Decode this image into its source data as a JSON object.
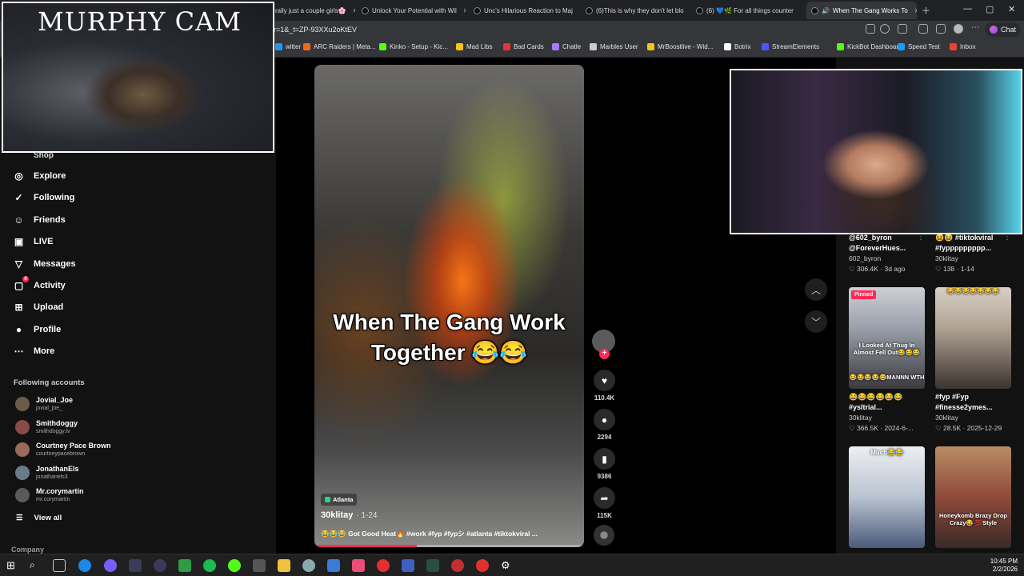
{
  "browser": {
    "tabs": [
      {
        "title": "rally just a couple girls🌸"
      },
      {
        "title": "Unlock Your Potential with Wil"
      },
      {
        "title": "Unc's Hilarious Reaction to Maj"
      },
      {
        "title": "(6)This is why they don't let blo"
      },
      {
        "title": "(6) 💙🌿 For all things counter"
      },
      {
        "title": "When The Gang Works To"
      }
    ],
    "url": "r=1&_t=ZP-93XXu2oKtEV",
    "chat_label": "Chat",
    "bookmarks": [
      {
        "label": "witter",
        "color": "#1d9bf0"
      },
      {
        "label": "ARC Raiders | Meta...",
        "color": "#f06a1d"
      },
      {
        "label": "Kinko - Setup - Kic...",
        "color": "#53fc18"
      },
      {
        "label": "Mad Libs",
        "color": "#f5c518"
      },
      {
        "label": "Bad Cards",
        "color": "#e33"
      },
      {
        "label": "Chatle",
        "color": "#a57cff"
      },
      {
        "label": "Marbles User",
        "color": "#ccc"
      },
      {
        "label": "MrBoostlive - Wid...",
        "color": "#f5c518"
      },
      {
        "label": "Botrix",
        "color": "#fff"
      },
      {
        "label": "StreamElements",
        "color": "#4b57ff"
      },
      {
        "label": "KickBot Dashboard",
        "color": "#53fc18"
      },
      {
        "label": "Speed Test",
        "color": "#1d9bf0"
      },
      {
        "label": "Inbox",
        "color": "#ea4335"
      }
    ]
  },
  "overlays": {
    "murphy_cam_title": "MURPHY CAM"
  },
  "sidebar": {
    "shop": "Shop",
    "items": [
      {
        "label": "Explore",
        "icon": "compass-icon",
        "glyph": "◎"
      },
      {
        "label": "Following",
        "icon": "following-icon",
        "glyph": "✓"
      },
      {
        "label": "Friends",
        "icon": "friends-icon",
        "glyph": "☺"
      },
      {
        "label": "LIVE",
        "icon": "live-icon",
        "glyph": "▣"
      },
      {
        "label": "Messages",
        "icon": "messages-icon",
        "glyph": "▽"
      },
      {
        "label": "Activity",
        "icon": "activity-icon",
        "glyph": "▢",
        "badge": "6"
      },
      {
        "label": "Upload",
        "icon": "upload-icon",
        "glyph": "⊞"
      },
      {
        "label": "Profile",
        "icon": "profile-icon",
        "glyph": "●"
      },
      {
        "label": "More",
        "icon": "more-icon",
        "glyph": "⋯"
      }
    ],
    "following_title": "Following accounts",
    "accounts": [
      {
        "name": "Jovial_Joe",
        "handle": "jovial_joe_"
      },
      {
        "name": "Smithdoggy",
        "handle": "smithdoggy.tv"
      },
      {
        "name": "Courtney Pace Brown",
        "handle": "courtneypacebrown"
      },
      {
        "name": "JonathanEls",
        "handle": "jonathanels3"
      },
      {
        "name": "Mr.corymartin",
        "handle": "mr.corymartin"
      }
    ],
    "view_all": "View all",
    "company": "Company"
  },
  "video": {
    "caption_line1": "When The Gang Work",
    "caption_line2": "Together 😂😂",
    "location": "Atlanta",
    "author": "30klitay",
    "date": "· 1-24",
    "description": "😂😂😂 Got Good Heat🔥 #work #fyp #fypシ #atlanta #tiktokviral ...",
    "progress": 0.38
  },
  "actions": {
    "likes": "110.4K",
    "comments": "2294",
    "saves": "9386",
    "shares": "115K"
  },
  "right_grid": [
    {
      "line1": "@602_byron",
      "line2": "@ForeverHues...",
      "author": "602_byron",
      "stats": "♡ 306.4K · 3d ago"
    },
    {
      "line1": "😆😆 #tiktokviral",
      "line2": "#fyppppppppp...",
      "author": "30klitay",
      "stats": "♡ 138 · 1-14"
    },
    {
      "line1": "😂😂😂😂😂😂",
      "line2": "#ysltrial...",
      "author": "30klitay",
      "stats": "♡ 366.5K · 2024-6-..."
    },
    {
      "line1": "#fyp #Fyp",
      "line2": "#finesse2ymes...",
      "author": "30klitay",
      "stats": "♡ 28.5K · 2025-12-29"
    }
  ],
  "thumbs": {
    "pinned": "Pinned",
    "t1_overlay": "I Looked At Thug In Almost Fell Out😂😂😂",
    "t1_bottom": "😂😂😂😂😂MANNN WTH",
    "t2_top": "😂😂😂😂😂😂😂",
    "t3_overlay": "Much😂😂",
    "t4_overlay": "Honeykomb Brazy Drop Crazy😂 💯Style"
  },
  "taskbar": {
    "time": "10:45 PM",
    "date": "2/2/2026"
  }
}
